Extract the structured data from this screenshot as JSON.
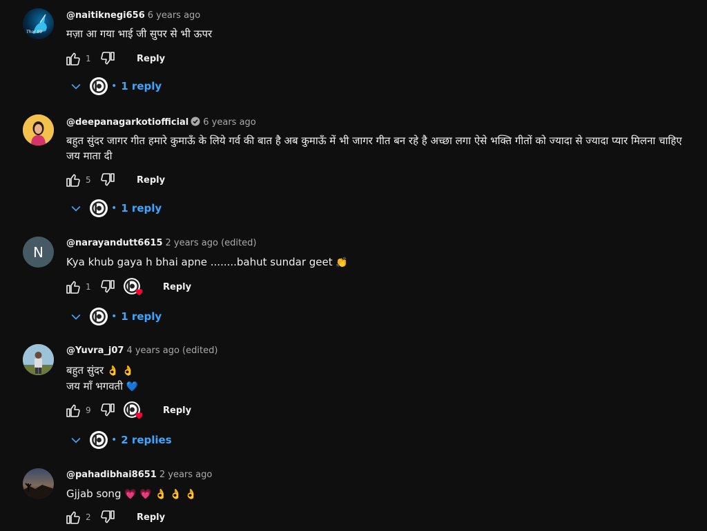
{
  "comments": [
    {
      "author": "@naitiknegi656",
      "time": "6 years ago",
      "text": "मज़ा आ गया भाई जी सुपर से भी ऊपर",
      "likes": "1",
      "reply_label": "Reply",
      "replies_label": "1 reply",
      "avatar_label": "Thor 99",
      "avatar_icon": "unicorn-avatar-icon"
    },
    {
      "author": "@deepanagarkotiofficial",
      "time": "6 years ago",
      "text": "बहुत सुंदर जागर गीत हमारे कुमाऊँ के लिये गर्व की बात है अब कुमाऊँ में भी जागर गीत बन रहे है अच्छा लगा ऐसे भक्ति गीतों को ज्यादा से ज्यादा प्यार मिलना चाहिए जय माता दी",
      "likes": "5",
      "reply_label": "Reply",
      "replies_label": "1 reply",
      "verified": true
    },
    {
      "author": "@narayandutt6615",
      "time": "2 years ago (edited)",
      "text": "Kya khub gaya h bhai apne ........bahut sundar geet",
      "emoji": "👏",
      "likes": "1",
      "reply_label": "Reply",
      "replies_label": "1 reply",
      "avatar_letter": "N",
      "creator_heart": true
    },
    {
      "author": "@Yuvra_j07",
      "time": "4 years ago (edited)",
      "text_line1": "बहुत सुंदर",
      "emoji_line1": "👌 👌",
      "text_line2": "जय माँ भगवती",
      "emoji_line2": "💙",
      "likes": "9",
      "reply_label": "Reply",
      "replies_label": "2 replies",
      "creator_heart": true
    },
    {
      "author": "@pahadibhai8651",
      "time": "2 years ago",
      "text": "Gjjab song",
      "emoji": "💗 💗 👌 👌 👌",
      "likes": "2",
      "reply_label": "Reply"
    }
  ],
  "colors": {
    "background": "#0f0f0f",
    "text": "#f1f1f1",
    "secondary": "#aaaaaa",
    "link": "#3ea6ff",
    "heart": "#ff0033"
  }
}
